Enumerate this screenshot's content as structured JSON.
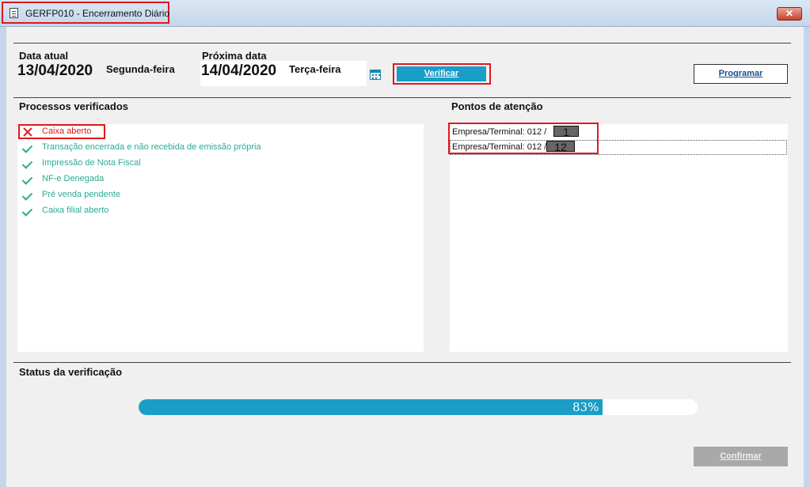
{
  "window": {
    "title": "GERFP010 - Encerramento Diário",
    "close_label": "✕"
  },
  "header": {
    "data_atual_label": "Data atual",
    "data_atual_value": "13/04/2020",
    "data_atual_day": "Segunda-feira",
    "proxima_data_label": "Próxima data",
    "proxima_data_value": "14/04/2020",
    "proxima_data_day": "Terça-feira",
    "calendar_icon": "calendar-icon",
    "verificar_label": "Verificar",
    "programar_label": "Programar"
  },
  "processos": {
    "title": "Processos verificados",
    "items": [
      {
        "label": "Caixa aberto",
        "status": "error",
        "color": "#e0181c"
      },
      {
        "label": "Transação encerrada e não recebida de emissão própria",
        "status": "ok",
        "color": "#2aab93"
      },
      {
        "label": "Impressão de Nota Fiscal",
        "status": "ok",
        "color": "#2aab93"
      },
      {
        "label": "NF-e Denegada",
        "status": "ok",
        "color": "#2aab93"
      },
      {
        "label": "Pré venda pendente",
        "status": "ok",
        "color": "#2aab93"
      },
      {
        "label": "Caixa filial aberto",
        "status": "ok",
        "color": "#2aab93"
      }
    ]
  },
  "pontos": {
    "title": "Pontos de atenção",
    "items": [
      {
        "label": "Empresa/Terminal: 012 /",
        "number": "1"
      },
      {
        "label": "Empresa/Terminal: 012 /",
        "number": "12"
      }
    ]
  },
  "status": {
    "title": "Status da verificação",
    "progress_percent": 83,
    "progress_label": "83%"
  },
  "footer": {
    "confirmar_label": "Confirmar"
  },
  "colors": {
    "accent": "#1a9ec7",
    "ok": "#2aab93",
    "error": "#e0181c"
  }
}
